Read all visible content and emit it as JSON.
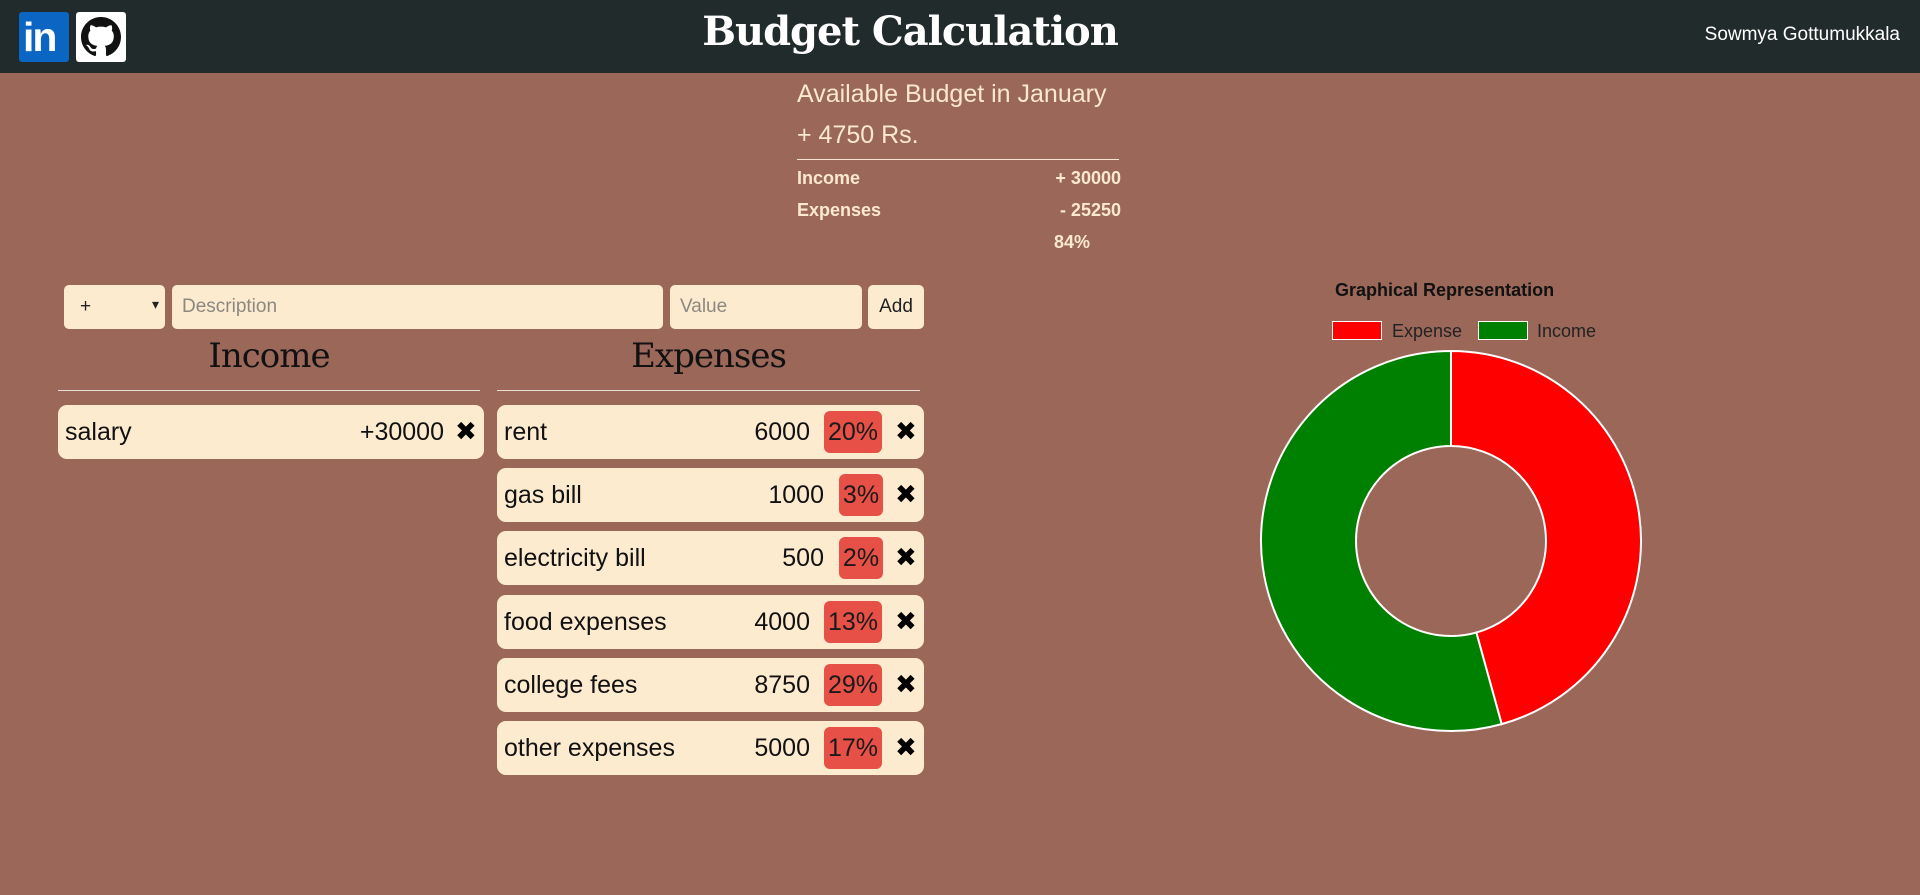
{
  "header": {
    "title": "Budget Calculation",
    "user_name": "Sowmya Gottumukkala",
    "linkedin_text": "in"
  },
  "budget": {
    "title": "Available Budget in January",
    "value": "+ 4750 Rs.",
    "income_label": "Income",
    "income_value": "+ 30000",
    "expenses_label": "Expenses",
    "expenses_value": "- 25250",
    "expenses_percent": "84%"
  },
  "input_bar": {
    "type_value": "+",
    "description_placeholder": "Description",
    "value_placeholder": "Value",
    "add_label": "Add"
  },
  "income": {
    "heading": "Income",
    "items": [
      {
        "description": "salary",
        "value": "+30000"
      }
    ]
  },
  "expenses": {
    "heading": "Expenses",
    "items": [
      {
        "description": "rent",
        "value": "6000",
        "percent": "20%"
      },
      {
        "description": "gas bill",
        "value": "1000",
        "percent": "3%"
      },
      {
        "description": "electricity bill",
        "value": "500",
        "percent": "2%"
      },
      {
        "description": "food expenses",
        "value": "4000",
        "percent": "13%"
      },
      {
        "description": "college fees",
        "value": "8750",
        "percent": "29%"
      },
      {
        "description": "other expenses",
        "value": "5000",
        "percent": "17%"
      }
    ]
  },
  "delete_glyph": "✖",
  "chart": {
    "title": "Graphical Representation",
    "expense_label": "Expense",
    "income_label": "Income",
    "expense_color": "#ff0000",
    "income_color": "#008000"
  },
  "chart_data": {
    "type": "pie",
    "categories": [
      "Expense",
      "Income"
    ],
    "values": [
      25250,
      30000
    ],
    "colors": [
      "#ff0000",
      "#008000"
    ],
    "title": "Graphical Representation",
    "legend": "top"
  }
}
